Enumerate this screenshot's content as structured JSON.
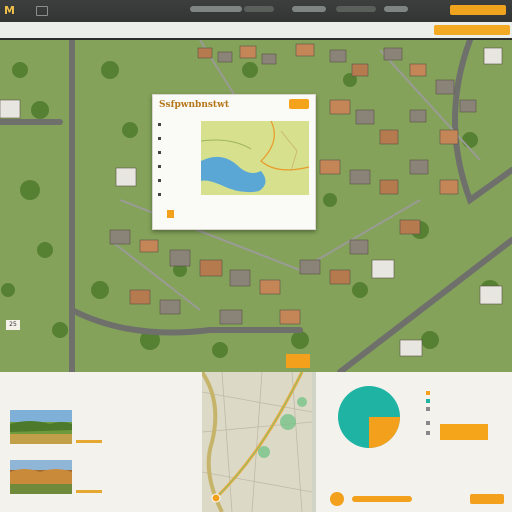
{
  "app": {
    "brand": "M",
    "map_number": "25"
  },
  "card": {
    "title": "Ssfpwnbnstwt",
    "close_label": "",
    "list": [
      "",
      "",
      "",
      "",
      "",
      ""
    ],
    "footer": [
      "",
      "",
      ""
    ]
  },
  "map_badge": {
    "label": ""
  },
  "left_panel": {
    "header": "",
    "items": [
      {
        "lines": [
          "",
          "",
          ""
        ],
        "right": [
          "",
          "",
          ""
        ]
      },
      {
        "lines": [
          "",
          "",
          ""
        ],
        "right": [
          "",
          "",
          ""
        ]
      }
    ]
  },
  "right_panel": {
    "header": "",
    "legend": [
      "",
      "",
      "",
      "",
      ""
    ],
    "footer": "",
    "donut": {
      "primary_share": 0.75
    }
  },
  "colors": {
    "accent": "#f3a01c",
    "teal": "#1fb3a3",
    "topbar": "#2f3231"
  }
}
